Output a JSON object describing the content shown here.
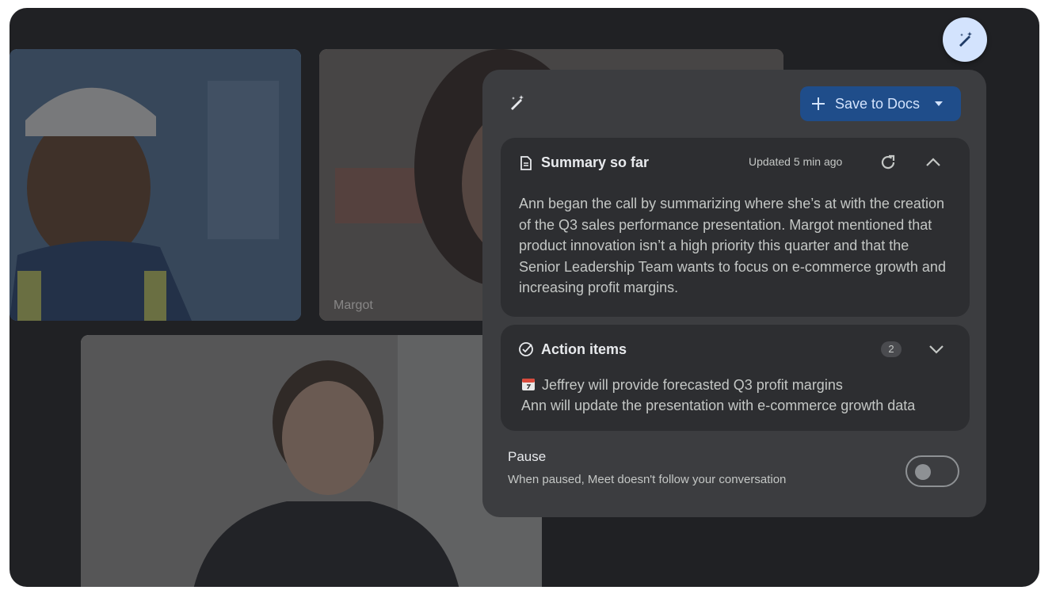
{
  "participants": [
    {
      "id": "p1"
    },
    {
      "id": "p2",
      "name": "Margot"
    },
    {
      "id": "p3"
    }
  ],
  "notes_button": {
    "icon": "pen-sparkle-icon"
  },
  "panel": {
    "top_icon": "pen-sparkle-icon",
    "save_button": {
      "label": "Save to Docs",
      "icon": "plus-icon",
      "menu_icon": "caret-down-icon"
    },
    "summary": {
      "title": "Summary so far",
      "icon": "document-icon",
      "updated": "Updated 5 min ago",
      "refresh_icon": "refresh-icon",
      "collapse_icon": "chevron-up-icon",
      "text": "Ann began the call by summarizing where she’s at with the creation of the Q3 sales performance presentation. Margot mentioned that product innovation isn’t a high priority this quarter and that the Senior Leadership Team wants to focus on e-commerce growth and increasing profit margins."
    },
    "action_items": {
      "title": "Action items",
      "icon": "check-circle-icon",
      "count": "2",
      "expand_icon": "chevron-down-icon",
      "items": [
        {
          "icon": "calendar-icon",
          "text": "Jeffrey will provide forecasted Q3 profit margins"
        },
        {
          "text": "Ann will update the presentation with e-commerce growth data"
        }
      ]
    },
    "pause": {
      "title": "Pause",
      "subtitle": "When paused, Meet doesn't follow your conversation",
      "enabled": false
    }
  },
  "colors": {
    "accent": "#1f4d8a",
    "panel": "#3c3d40",
    "card": "#2d2e31",
    "fab": "#d3e3fd"
  }
}
